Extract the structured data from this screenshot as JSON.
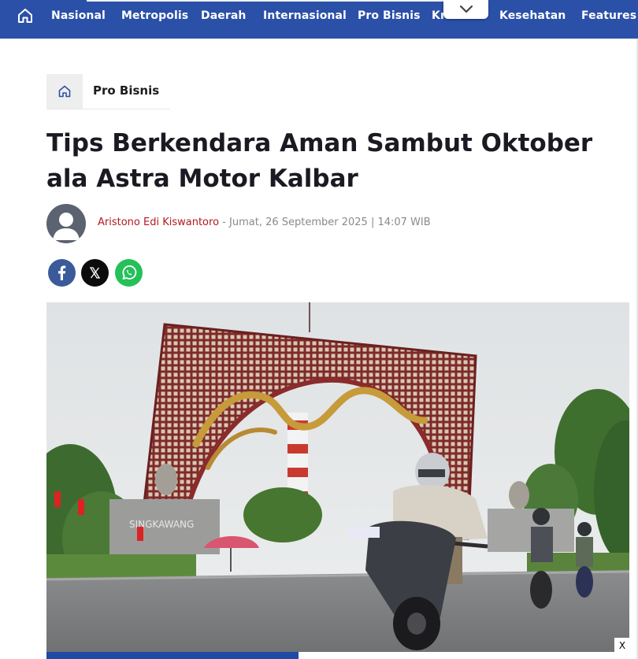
{
  "nav": {
    "items": [
      "Nasional",
      "Metropolis",
      "Daerah",
      "Internasional",
      "Pro Bisnis",
      "Kriminal",
      "Kesehatan",
      "Features"
    ]
  },
  "breadcrumb": {
    "label": "Pro Bisnis"
  },
  "article": {
    "title": "Tips Berkendara Aman Sambut Oktober ala Astra Motor Kalbar",
    "author": "Aristono Edi Kiswantoro",
    "separator": " - ",
    "date": "Jumat, 26 September 2025 | 14:07 WIB"
  },
  "share": {
    "icons": [
      "facebook-icon",
      "x-icon",
      "whatsapp-icon"
    ]
  },
  "image": {
    "gate_text": "SINGKAWANG"
  },
  "ad": {
    "close_label": "X"
  },
  "colors": {
    "nav": "#2b50a8",
    "author": "#b3191f",
    "title": "#1a1a22"
  }
}
